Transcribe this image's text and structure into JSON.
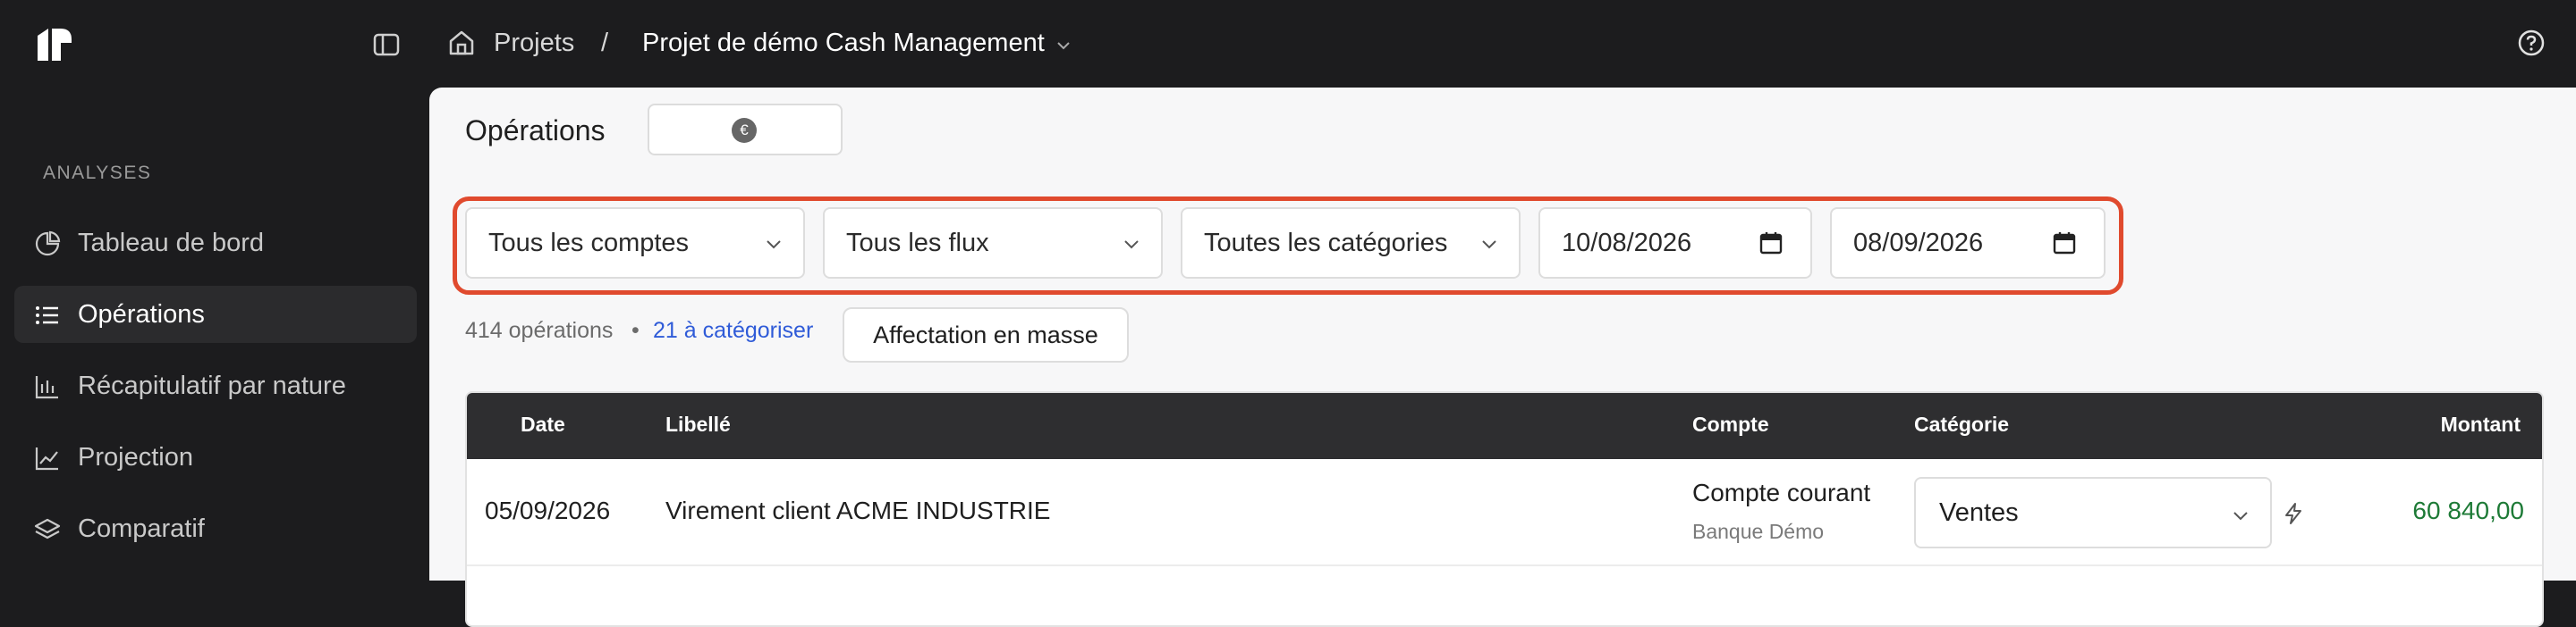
{
  "header": {
    "home_icon": "home-icon",
    "breadcrumb": {
      "projects": "Projets",
      "separator": "/",
      "current": "Projet de démo Cash Management"
    },
    "help_icon": "help-circle-icon"
  },
  "sidebar": {
    "section_label": "ANALYSES",
    "items": [
      {
        "label": "Tableau de bord",
        "icon": "pie-chart-icon",
        "active": false
      },
      {
        "label": "Opérations",
        "icon": "list-icon",
        "active": true
      },
      {
        "label": "Récapitulatif par nature",
        "icon": "bar-chart-icon",
        "active": false
      },
      {
        "label": "Projection",
        "icon": "line-chart-icon",
        "active": false
      },
      {
        "label": "Comparatif",
        "icon": "layers-icon",
        "active": false
      }
    ]
  },
  "main": {
    "title": "Opérations",
    "currency_symbol": "€",
    "filters": {
      "accounts": "Tous les comptes",
      "flows": "Tous les flux",
      "categories": "Toutes les catégories",
      "date_from": "10/08/2026",
      "date_to": "08/09/2026"
    },
    "meta": {
      "count": "414 opérations",
      "bullet": "•",
      "to_categorize": "21 à catégoriser"
    },
    "mass_assign_label": "Affectation en masse",
    "table": {
      "headers": {
        "date": "Date",
        "label": "Libellé",
        "account": "Compte",
        "category": "Catégorie",
        "amount": "Montant"
      },
      "rows": [
        {
          "date": "05/09/2026",
          "label": "Virement client ACME INDUSTRIE",
          "account": "Compte courant",
          "bank": "Banque Démo",
          "category": "Ventes",
          "amount": "60 840,00"
        }
      ]
    }
  },
  "colors": {
    "accent_border": "#e04a2e",
    "link": "#2f5bd8",
    "positive_amount": "#1d7a36",
    "dark_bg": "#1c1c1e"
  }
}
